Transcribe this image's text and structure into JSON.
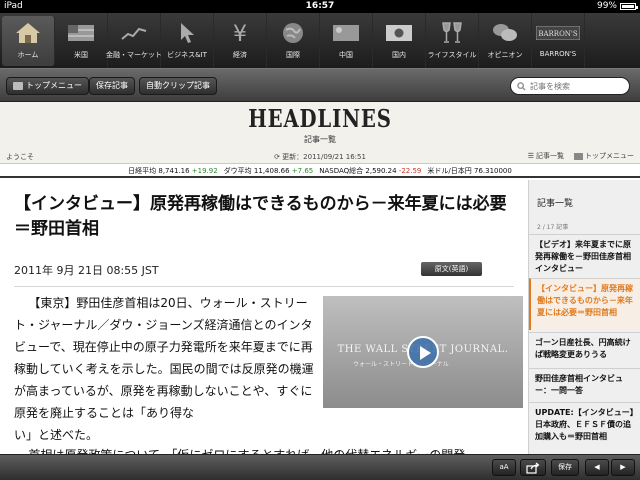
{
  "statusbar": {
    "device": "iPad",
    "time": "16:57",
    "battery": "99%"
  },
  "categories": [
    {
      "label": "ホーム",
      "icon": "home-icon",
      "active": true
    },
    {
      "label": "米国",
      "icon": "us-flag-icon"
    },
    {
      "label": "金融・マーケット",
      "icon": "market-chart-icon"
    },
    {
      "label": "ビジネス&IT",
      "icon": "cursor-icon"
    },
    {
      "label": "経済",
      "icon": "yen-icon"
    },
    {
      "label": "国際",
      "icon": "globe-icon"
    },
    {
      "label": "中国",
      "icon": "china-flag-icon"
    },
    {
      "label": "国内",
      "icon": "japan-flag-icon"
    },
    {
      "label": "ライフスタイル",
      "icon": "wine-glasses-icon"
    },
    {
      "label": "オピニオン",
      "icon": "speech-bubbles-icon"
    },
    {
      "label": "BARRON'S",
      "icon": "barrons-logo-icon"
    }
  ],
  "toolbar": {
    "top_menu": "トップメニュー",
    "saved": "保存記事",
    "auto_clip": "自動クリップ記事",
    "search_placeholder": "記事を検索"
  },
  "masthead": {
    "title": "HEADLINES",
    "subtitle": "記事一覧",
    "welcome": "ようこそ",
    "updated": "更新：2011/09/21 16:51",
    "article_list": "記事一覧",
    "top_menu": "トップメニュー"
  },
  "ticker": {
    "nikkei_label": "日経平均",
    "nikkei_value": "8,741.16",
    "nikkei_change": "+19.92",
    "dow_label": "ダウ平均",
    "dow_value": "11,408.66",
    "dow_change": "+7.65",
    "nasdaq_label": "NASDAQ総合",
    "nasdaq_value": "2,590.24",
    "nasdaq_change": "-22.59",
    "usdjpy_label": "米ドル/日本円",
    "usdjpy_value": "76.310000"
  },
  "article": {
    "headline": "【インタビュー】原発再稼働はできるものから－来年夏には必要＝野田首相",
    "date": "2011年 9月 21日 08:55 JST",
    "original_button": "原文(英語)",
    "body_p1": "【東京】野田佳彦首相は20日、ウォール・ストリート・ジャーナル／ダウ・ジョーンズ経済通信とのインタビューで、現在停止中の原子力発電所を来年夏までに再稼動していく考えを示した。国民の間では反原発の機運が高まっているが、原発を再稼動しないことや、すぐに原発を廃止することは「あり得な",
    "body_p1_end": "い」と述べた。",
    "body_p2": "首相は原発政策について、「仮にゼロにするとすれば、他の代替エネルギーの開発",
    "video_title": "THE WALL STREET JOURNAL.",
    "video_sub": "ウォール・ストリート・ジャーナル"
  },
  "sidebar": {
    "title": "記事一覧",
    "count": "2 / 17 記事",
    "items": [
      "【ビデオ】来年夏までに原発再稼働を－野田佳彦首相インタビュー",
      "【インタビュー】原発再稼働はできるものから－来年夏には必要＝野田首相",
      "ゴーン日産社長、円高続けば戦略変更ありうる",
      "野田佳彦首相インタビュー：一問一答",
      "UPDATE:【インタビュー】日本政府、ＥＦＳＦ債の追加購入も＝野田首相"
    ]
  },
  "bottombar": {
    "font_size": "aA",
    "save": "保存"
  },
  "colors": {
    "accent_orange": "#e07a1f",
    "up_green": "#2f8a2f",
    "down_red": "#c0392b"
  }
}
